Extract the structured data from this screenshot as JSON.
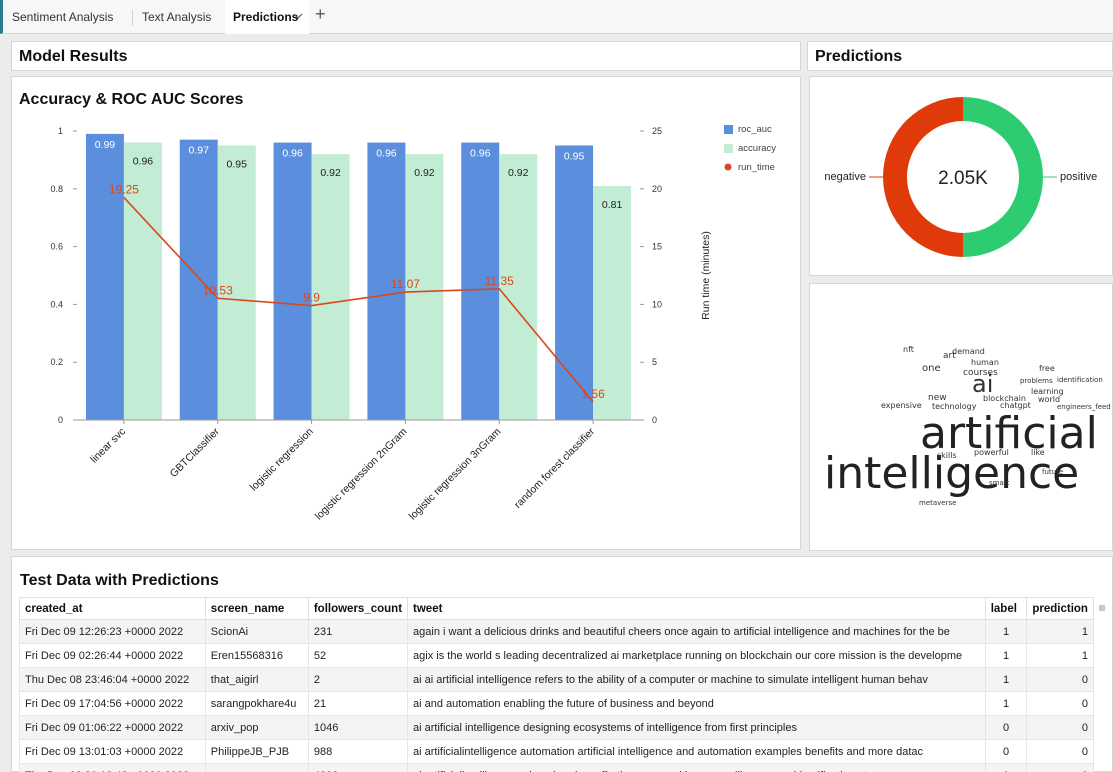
{
  "tabs": [
    {
      "label": "Sentiment Analysis"
    },
    {
      "label": "Text Analysis"
    },
    {
      "label": "Predictions"
    }
  ],
  "sections": {
    "model_results": "Model Results",
    "predictions": "Predictions",
    "test_data": "Test Data with Predictions"
  },
  "chart_data": [
    {
      "type": "bar",
      "title": "Accuracy & ROC AUC Scores",
      "categories": [
        "linear svc",
        "GBTClassifier",
        "logistic regression",
        "logistic regression 2nGram",
        "logistic regression 3nGram",
        "random forest classifier"
      ],
      "series": [
        {
          "name": "roc_auc",
          "type": "bar",
          "color": "#5b8fde",
          "values": [
            0.99,
            0.97,
            0.96,
            0.96,
            0.96,
            0.95
          ]
        },
        {
          "name": "accuracy",
          "type": "bar",
          "color": "#c3ecd4",
          "values": [
            0.96,
            0.95,
            0.92,
            0.92,
            0.92,
            0.81
          ]
        },
        {
          "name": "run_time",
          "type": "line",
          "color": "#d9481c",
          "axis": "right",
          "values": [
            19.25,
            10.53,
            9.9,
            11.07,
            11.35,
            1.56
          ]
        }
      ],
      "ylim": [
        0,
        1
      ],
      "yticks": [
        "0",
        "0.2",
        "0.4",
        "0.6",
        "0.8",
        "1"
      ],
      "y2lim": [
        0,
        25
      ],
      "y2ticks": [
        "0",
        "5",
        "10",
        "15",
        "20",
        "25"
      ],
      "y2label": "Run time (minutes)",
      "legend": "top-right"
    },
    {
      "type": "pie",
      "center_label": "2.05K",
      "slices": [
        {
          "name": "positive",
          "value": 0.5,
          "color": "#2ecc71"
        },
        {
          "name": "negative",
          "value": 0.5,
          "color": "#e03a0a"
        }
      ]
    }
  ],
  "wordcloud": {
    "words": [
      {
        "t": "artificial",
        "s": 44,
        "x": 0,
        "y": 0
      },
      {
        "t": "intelligence",
        "s": 44,
        "x": 0,
        "y": 0
      },
      {
        "t": "ai",
        "s": 24
      },
      {
        "t": "one"
      },
      {
        "t": "courses"
      },
      {
        "t": "art"
      },
      {
        "t": "human"
      },
      {
        "t": "new"
      },
      {
        "t": "world"
      },
      {
        "t": "chatgpt"
      },
      {
        "t": "technology"
      },
      {
        "t": "expensive"
      },
      {
        "t": "blockchain"
      },
      {
        "t": "learning"
      },
      {
        "t": "powerful"
      },
      {
        "t": "like"
      },
      {
        "t": "skills"
      },
      {
        "t": "future"
      },
      {
        "t": "smart"
      },
      {
        "t": "metaverse"
      },
      {
        "t": "nft"
      },
      {
        "t": "demand"
      },
      {
        "t": "free"
      },
      {
        "t": "problems"
      },
      {
        "t": "identification"
      },
      {
        "t": "engineers_feed"
      }
    ]
  },
  "table": {
    "columns": [
      "created_at",
      "screen_name",
      "followers_count",
      "tweet",
      "label",
      "prediction"
    ],
    "rows": [
      [
        "Fri Dec 09 12:26:23 +0000 2022",
        "ScionAi",
        "231",
        "again i want a delicious drinks and beautiful cheers once again to artificial intelligence and machines for the be",
        "1",
        "1"
      ],
      [
        "Fri Dec 09 02:26:44 +0000 2022",
        "Eren15568316",
        "52",
        "agix is the world s leading decentralized ai marketplace running on blockchain our core mission is the developme",
        "1",
        "1"
      ],
      [
        "Thu Dec 08 23:46:04 +0000 2022",
        "that_aigirl",
        "2",
        "ai ai artificial intelligence refers to the ability of a computer or machine to simulate intelligent human behav",
        "1",
        "0"
      ],
      [
        "Fri Dec 09 17:04:56 +0000 2022",
        "sarangpokhare4u",
        "21",
        "ai and automation enabling the future of business and beyond",
        "1",
        "0"
      ],
      [
        "Fri Dec 09 01:06:22 +0000 2022",
        "arxiv_pop",
        "1046",
        "ai artificial intelligence designing ecosystems of intelligence from first principles",
        "0",
        "0"
      ],
      [
        "Fri Dec 09 13:01:03 +0000 2022",
        "PhilippeJB_PJB",
        "988",
        "ai artificialintelligence automation artificial intelligence and automation examples benefits and more datac",
        "0",
        "0"
      ],
      [
        "Thu Dec 08 20:19:42 +0000 2022",
        "rvp",
        "4832",
        "ai artificialintelligence ml rvp berniespofforth eu mass citizen surveillance amp identification starts",
        "1",
        "0"
      ]
    ]
  }
}
